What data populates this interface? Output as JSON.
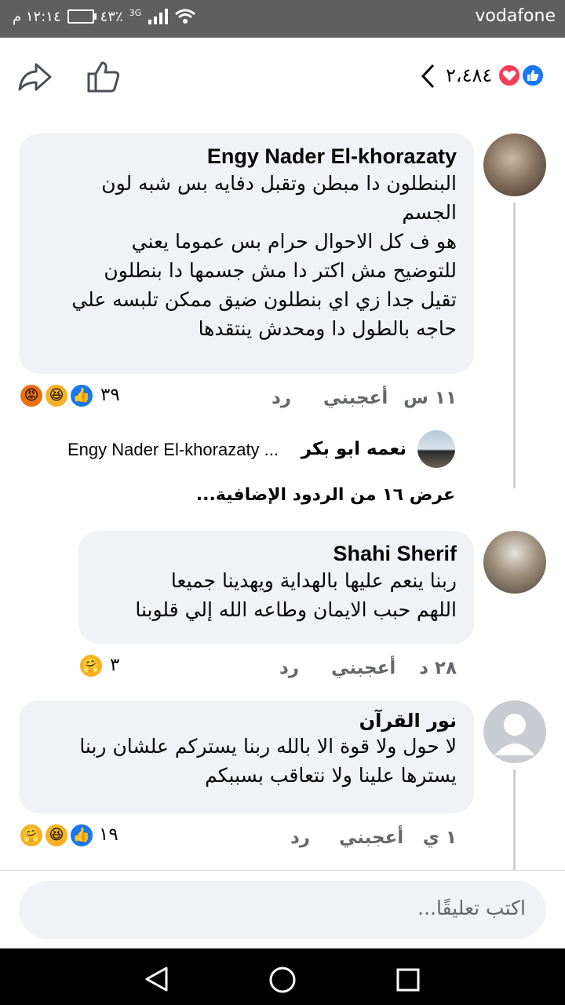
{
  "status_bar": {
    "carrier": "vodafone",
    "time": "١٢:١٤ م",
    "battery": "٤٣٪",
    "network": "3G"
  },
  "header": {
    "reaction_count": "٢،٤٨٤",
    "reaction_icons": [
      "like-icon",
      "love-icon"
    ]
  },
  "comments": [
    {
      "author": "Engy Nader El-khorazaty",
      "text": "البنطلون دا مبطن وتقبل دفايه بس شبه لون\nالجسم\nهو ف كل الاحوال حرام بس عموما يعني\nللتوضيح مش اكتر دا مش جسمها دا بنطلون\nتقيل جدا زي اي بنطلون ضيق ممكن تلبسه علي\nحاجه بالطول دا ومحدش ينتقدها",
      "time": "١١ س",
      "like_label": "أعجبني",
      "reply_label": "رد",
      "reaction_count": "٣٩",
      "reactions": [
        "like",
        "haha",
        "angry"
      ],
      "reply_preview": {
        "author": "نعمه ابو بكر",
        "text": "Engy Nader El-khorazaty ..."
      },
      "more_replies": "عرض ١٦ من الردود الإضافية..."
    },
    {
      "author": "Shahi Sherif",
      "text": "ربنا ينعم عليها بالهداية ويهدينا جميعا\nاللهم حبب الايمان وطاعه الله  إلي قلوبنا",
      "time": "٢٨ د",
      "like_label": "أعجبني",
      "reply_label": "رد",
      "reaction_count": "٣",
      "reactions": [
        "care"
      ]
    },
    {
      "author": "نور القرآن",
      "text": "لا حول ولا قوة الا بالله ربنا يستركم علشان ربنا\nيسترها علينا ولا نتعاقب بسببكم",
      "time": "١ ي",
      "like_label": "أعجبني",
      "reply_label": "رد",
      "reaction_count": "١٩",
      "reactions": [
        "like",
        "haha",
        "care"
      ]
    }
  ],
  "composer": {
    "placeholder": "اكتب تعليقًا..."
  },
  "colors": {
    "like_blue": "#1877f2",
    "love_red": "#f33e58",
    "bubble_bg": "#f0f2f5",
    "meta_gray": "#65676b"
  }
}
